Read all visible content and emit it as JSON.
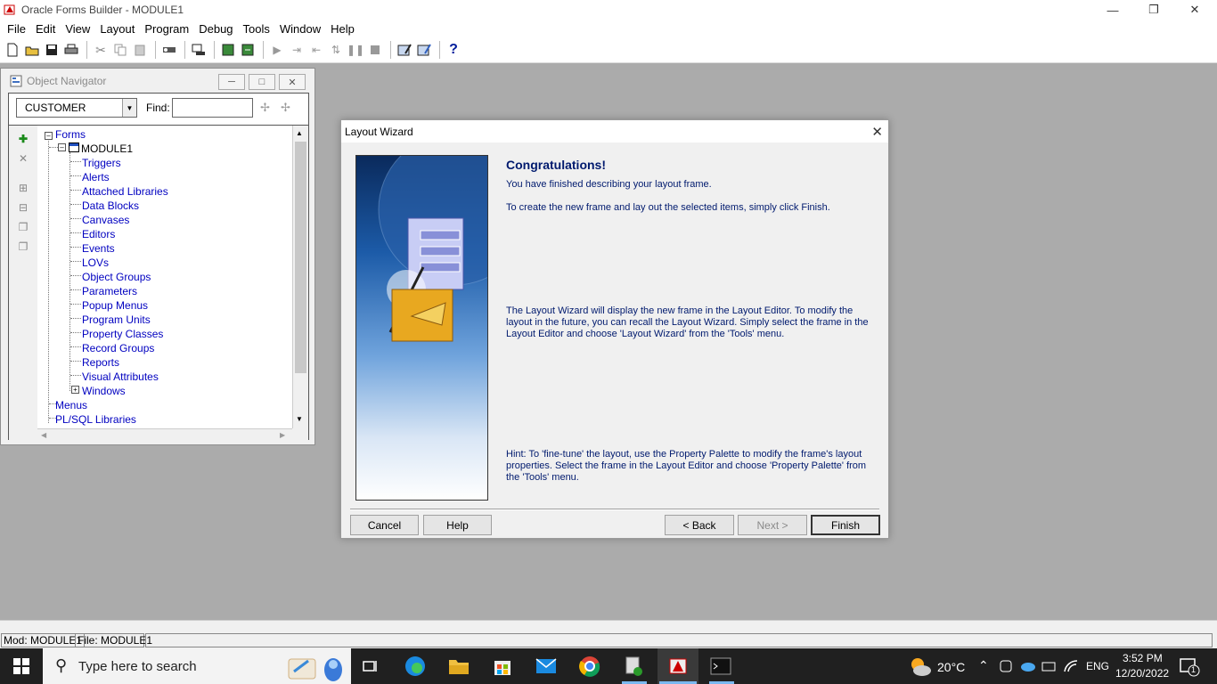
{
  "window": {
    "title": "Oracle Forms Builder - MODULE1",
    "icon": "oracle-forms-icon",
    "controls": [
      "minimize-icon",
      "restore-icon",
      "close-icon"
    ]
  },
  "menubar": {
    "items": [
      "File",
      "Edit",
      "View",
      "Layout",
      "Program",
      "Debug",
      "Tools",
      "Window",
      "Help"
    ]
  },
  "toolbar": {
    "buttons": [
      "new-icon",
      "open-icon",
      "save-icon",
      "print-icon",
      "cut-icon",
      "copy-icon",
      "paste-icon",
      "connect-icon",
      "compile-icon",
      "run-form-icon",
      "run-debug-icon",
      "step-icon",
      "step-into-icon",
      "step-over-icon",
      "step-out-icon",
      "pause-icon",
      "stop-icon",
      "wizard-icon",
      "layout-wizard-icon",
      "help-icon"
    ]
  },
  "navigator": {
    "title": "Object Navigator",
    "combo_value": "CUSTOMER",
    "find_label": "Find:",
    "find_value": "",
    "tree": {
      "forms": "Forms",
      "module": "MODULE1",
      "children": [
        "Triggers",
        "Alerts",
        "Attached Libraries",
        "Data Blocks",
        "Canvases",
        "Editors",
        "Events",
        "LOVs",
        "Object Groups",
        "Parameters",
        "Popup Menus",
        "Program Units",
        "Property Classes",
        "Record Groups",
        "Reports",
        "Visual Attributes",
        "Windows"
      ],
      "menus": "Menus",
      "plsql": "PL/SQL Libraries"
    }
  },
  "dialog": {
    "title": "Layout Wizard",
    "heading": "Congratulations!",
    "line1": "You have finished describing your layout frame.",
    "line2": "To create the new frame and lay out the selected items, simply click Finish.",
    "para": "The Layout Wizard will display the new frame in the Layout Editor. To modify the layout in the future, you can recall the Layout Wizard. Simply select the frame in the Layout Editor and choose 'Layout Wizard' from the 'Tools' menu.",
    "hint": "Hint: To 'fine-tune' the layout, use the Property Palette to modify the frame's layout properties. Select the frame in the Layout Editor and choose 'Property Palette' from the 'Tools' menu.",
    "buttons": {
      "cancel": "Cancel",
      "help": "Help",
      "back": "< Back",
      "next": "Next >",
      "finish": "Finish"
    }
  },
  "status": {
    "mod": "Mod: MODULE1",
    "file": "File: MODULE1"
  },
  "taskbar": {
    "search_placeholder": "Type here to search",
    "weather": "20°C",
    "lang": "ENG",
    "time": "3:52 PM",
    "date": "12/20/2022",
    "notifications": "1",
    "accent": "#0078d7"
  }
}
